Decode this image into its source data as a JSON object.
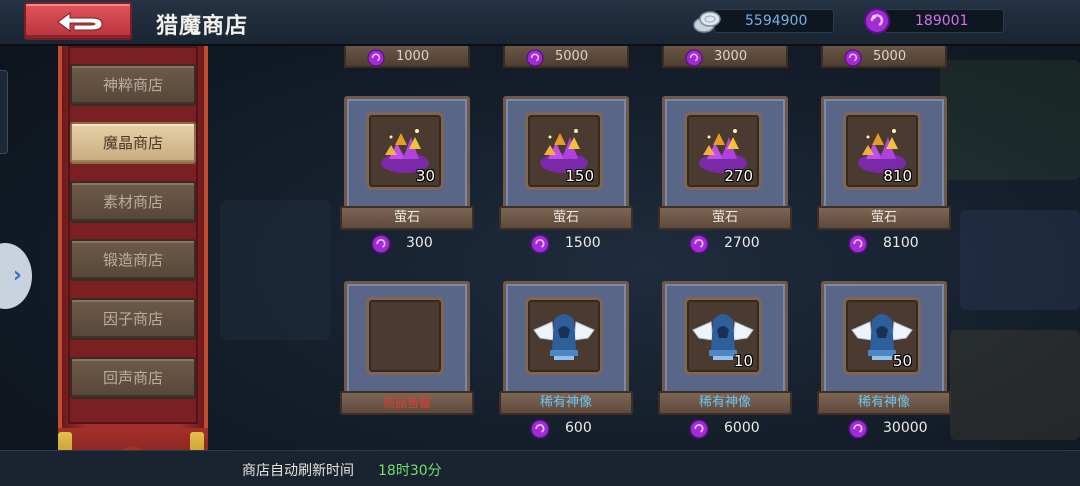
{
  "header": {
    "title": "猎魔商店",
    "coins": "5594900",
    "gems": "189001"
  },
  "nav": {
    "items": [
      {
        "label": "神粹商店",
        "active": false
      },
      {
        "label": "魔晶商店",
        "active": true
      },
      {
        "label": "素材商店",
        "active": false
      },
      {
        "label": "锻造商店",
        "active": false
      },
      {
        "label": "因子商店",
        "active": false
      },
      {
        "label": "回声商店",
        "active": false
      }
    ]
  },
  "shop": {
    "partial_row_prices": [
      "1000",
      "5000",
      "3000",
      "5000"
    ],
    "items": [
      {
        "name": "萤石",
        "qty": "30",
        "price": "300",
        "icon": "crystal-pile-icon"
      },
      {
        "name": "萤石",
        "qty": "150",
        "price": "1500",
        "icon": "crystal-pile-icon"
      },
      {
        "name": "萤石",
        "qty": "270",
        "price": "2700",
        "icon": "crystal-pile-icon"
      },
      {
        "name": "萤石",
        "qty": "810",
        "price": "8100",
        "icon": "crystal-pile-icon"
      },
      {
        "name": "商品售罄",
        "qty": "",
        "price": "",
        "icon": "",
        "sold_out": true
      },
      {
        "name": "稀有神像",
        "qty": "",
        "price": "600",
        "icon": "winged-statue-icon"
      },
      {
        "name": "稀有神像",
        "qty": "10",
        "price": "6000",
        "icon": "winged-statue-icon"
      },
      {
        "name": "稀有神像",
        "qty": "50",
        "price": "30000",
        "icon": "winged-statue-icon"
      }
    ]
  },
  "footer": {
    "refresh_label": "商店自动刷新时间",
    "refresh_time": "18时30分"
  },
  "colors": {
    "accent_red": "#c4383e",
    "gem_purple": "#a12bd6",
    "refresh_green": "#6ee06a",
    "item_name_blue": "#6fc3f0",
    "sold_out_red": "#e23b35"
  }
}
